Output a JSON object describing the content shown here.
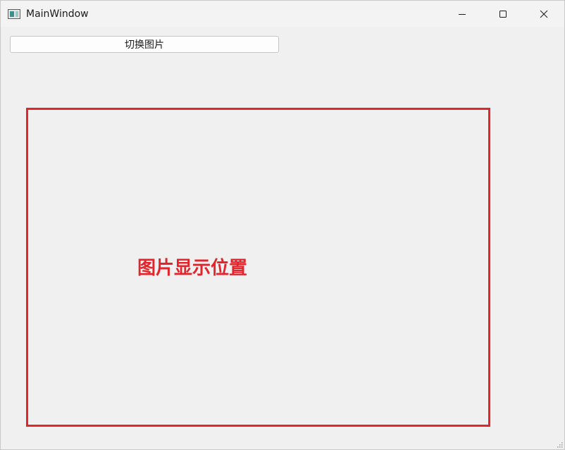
{
  "window": {
    "title": "MainWindow"
  },
  "titlebar": {
    "icons": {
      "app": "app-window-icon",
      "minimize": "minimize-icon",
      "maximize": "maximize-icon",
      "close": "close-icon"
    }
  },
  "toolbar": {
    "switch_image_label": "切换图片"
  },
  "image_area": {
    "placeholder_text": "图片显示位置",
    "border_color": "#e3242b"
  },
  "colors": {
    "background": "#f0f0f0",
    "accent_red": "#e3242b"
  }
}
